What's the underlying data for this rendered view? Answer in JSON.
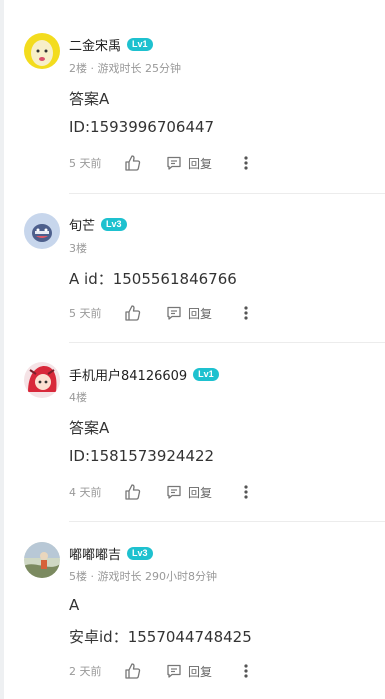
{
  "comments": [
    {
      "username": "二金宋禹",
      "level": "Lv1",
      "meta": "2楼 · 游戏时长 25分钟",
      "lines": [
        "答案A",
        "ID:1593996706447"
      ],
      "time": "5 天前",
      "reply_label": "回复"
    },
    {
      "username": "旬芒",
      "level": "Lv3",
      "meta": "3楼",
      "lines": [
        "A  id：1505561846766"
      ],
      "time": "5 天前",
      "reply_label": "回复"
    },
    {
      "username": "手机用户84126609",
      "level": "Lv1",
      "meta": "4楼",
      "lines": [
        "答案A",
        "ID:1581573924422"
      ],
      "time": "4 天前",
      "reply_label": "回复"
    },
    {
      "username": "嘟嘟嘟吉",
      "level": "Lv3",
      "meta": "5楼 · 游戏时长 290小时8分钟",
      "lines": [
        "A",
        "安卓id：1557044748425"
      ],
      "time": "2 天前",
      "reply_label": "回复"
    }
  ],
  "colors": {
    "level_badge": "#1ec1cf",
    "meta_text": "#999999",
    "body_text": "#333333"
  },
  "icons": {
    "like": "thumbs-up-icon",
    "reply": "comment-bubble-icon",
    "more": "more-vertical-icon"
  }
}
